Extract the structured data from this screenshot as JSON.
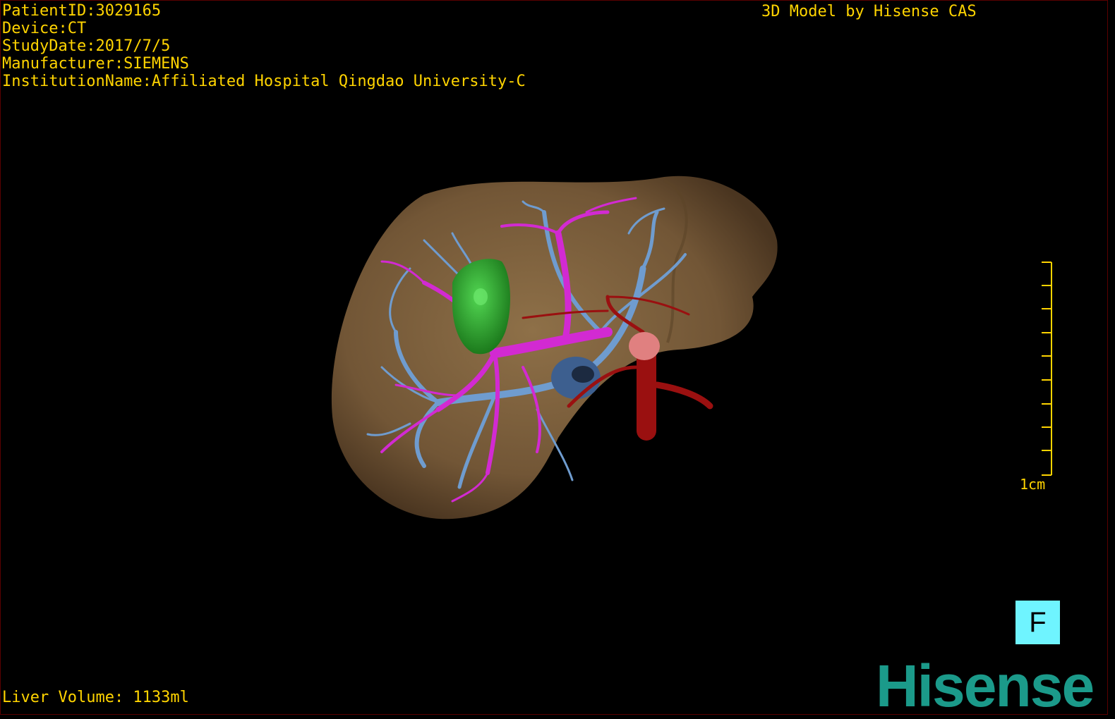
{
  "overlay": {
    "patient_id": "PatientID:3029165",
    "device": "Device:CT",
    "study_date": "StudyDate:2017/7/5",
    "manufacturer": "Manufacturer:SIEMENS",
    "institution": "InstitutionName:Affiliated Hospital Qingdao University-C",
    "credit": "3D Model by Hisense CAS",
    "liver_volume": "Liver Volume: 1133ml"
  },
  "scale": {
    "label": "1cm",
    "ticks": 10
  },
  "orientation": {
    "label": "F",
    "color": "#6ff4ff"
  },
  "brand": {
    "name": "Hisense",
    "color": "#1b9a8a"
  },
  "colors": {
    "overlay_text": "#ffd400",
    "liver": "#7a5f3d",
    "portal_vein": "#d22ad2",
    "hepatic_vein": "#6f9ccf",
    "tumor": "#2ea82e",
    "artery": "#9a1010"
  }
}
